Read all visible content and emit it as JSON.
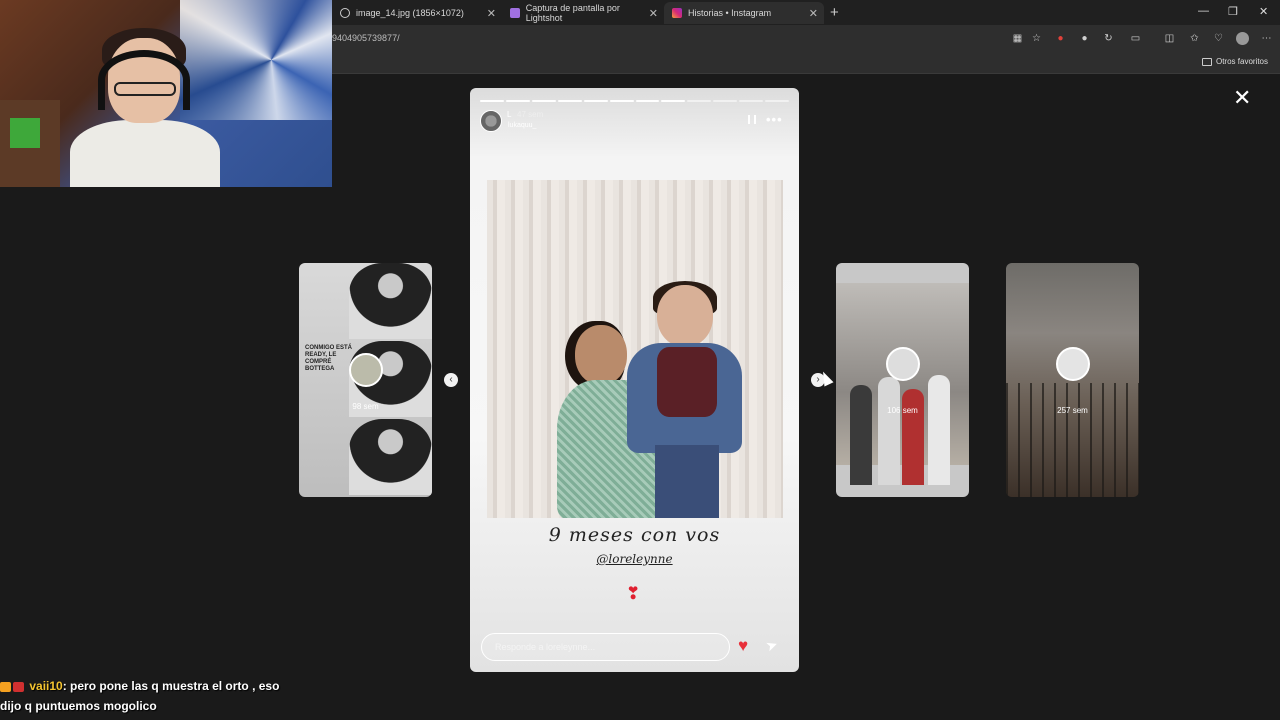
{
  "browser": {
    "tabs": [
      {
        "title": "image_14.jpg (1856×1072)",
        "icon": "globe-icon"
      },
      {
        "title": "Captura de pantalla por Lightshot",
        "icon": "feather-icon"
      },
      {
        "title": "Historias • Instagram",
        "icon": "instagram-icon",
        "active": true
      }
    ],
    "new_tab": "+",
    "url": "9404905739877/",
    "favorites_label": "Otros favoritos",
    "window": {
      "minimize": "—",
      "restore": "❐",
      "close": "✕"
    }
  },
  "viewer": {
    "close": "✕",
    "prev_arrow": "‹",
    "next_arrow": "›",
    "side_cards": [
      {
        "time": "98 sem",
        "text": "CONMIGO ESTÁ READY, LE COMPRÉ BOTTEGA"
      },
      {
        "time": "106 sem"
      },
      {
        "time": "257 sem"
      }
    ],
    "story": {
      "progress_total": 12,
      "progress_done": 8,
      "username": "L",
      "time": "47 sem",
      "subline": "lukaquu_",
      "caption": "9 meses con vos",
      "mention": "@loreleynne",
      "emoji": "❣",
      "reply_placeholder": "Responde a loreleynne...",
      "like_icon": "♥",
      "send_icon": "➤",
      "more_icon": "•••"
    }
  },
  "chat": {
    "username": "vaii10",
    "message": ": pero pone las q muestra el orto , eso",
    "message2": "dijo q puntuemos mogolico"
  }
}
